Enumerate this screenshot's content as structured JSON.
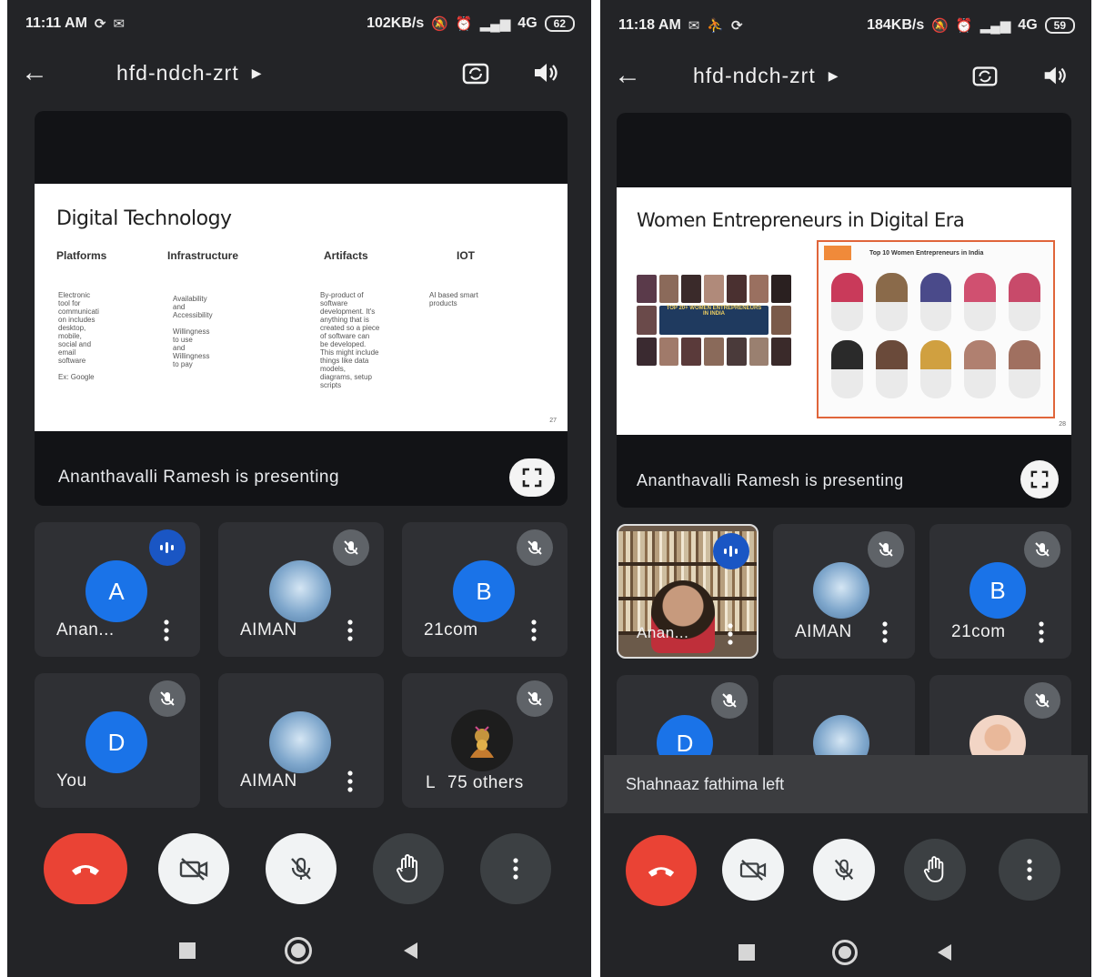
{
  "left": {
    "status": {
      "time": "11:11 AM",
      "speed": "102KB/s",
      "network": "4G",
      "battery": "62"
    },
    "meeting_title": "hfd-ndch-zrt",
    "slide": {
      "title": "Digital Technology",
      "columns": [
        {
          "head": "Platforms",
          "body": "Electronic\ntool for\ncommunicati\non includes\ndesktop,\nmobile,\nsocial and\nemail\nsoftware\n\nEx: Google"
        },
        {
          "head": "Infrastructure",
          "body": "Availability\nand\nAccessibility\n\nWillingness\nto use\nand\nWillingness\nto pay"
        },
        {
          "head": "Artifacts",
          "body": "By-product of\nsoftware\ndevelopment. It's\nanything that is\ncreated so a piece\nof software can\nbe developed.\nThis might include\nthings like data\nmodels,\ndiagrams, setup\nscripts"
        },
        {
          "head": "IOT",
          "body": "AI based smart\nproducts"
        }
      ],
      "page": "27"
    },
    "presenting": "Ananthavalli Ramesh is presenting",
    "tiles": [
      {
        "name": "Anan...",
        "initial": "A"
      },
      {
        "name": "AIMAN"
      },
      {
        "name": "21com",
        "initial": "B"
      },
      {
        "name": "You",
        "initial": "D"
      },
      {
        "name": "AIMAN"
      },
      {
        "name": "75 others",
        "overlap_letter": "L"
      }
    ]
  },
  "right": {
    "status": {
      "time": "11:18 AM",
      "speed": "184KB/s",
      "network": "4G",
      "battery": "59"
    },
    "meeting_title": "hfd-ndch-zrt",
    "slide": {
      "title": "Women Entrepreneurs in Digital Era",
      "collage_label": "TOP 20+ WOMEN ENTREPRENEURS IN INDIA",
      "panel_title": "Top 10 Women Entrepreneurs in India",
      "page": "28"
    },
    "presenting": "Ananthavalli Ramesh is presenting",
    "tiles": [
      {
        "name": "Anan..."
      },
      {
        "name": "AIMAN"
      },
      {
        "name": "21com",
        "initial": "B"
      },
      {
        "initial": "D"
      }
    ],
    "toast": "Shahnaaz fathima left"
  },
  "colors": {
    "end_call": "#ea4335",
    "avatar_blue": "#1a73e8",
    "background": "#232427"
  }
}
